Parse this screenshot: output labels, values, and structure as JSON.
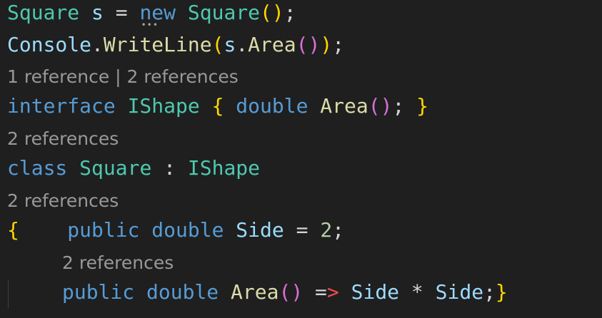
{
  "code": {
    "line1": {
      "type_square": "Square",
      "var_s": " s ",
      "eq": "= ",
      "kw_new": "new",
      "sp": " ",
      "type_square2": "Square",
      "paren_open": "(",
      "paren_close": ")",
      "semi": ";"
    },
    "line2": {
      "console": "Console",
      "dot": ".",
      "writeline": "WriteLine",
      "paren_open": "(",
      "s": "s",
      "dot2": ".",
      "area": "Area",
      "inner_open": "(",
      "inner_close": ")",
      "paren_close": ")",
      "semi": ";"
    },
    "lens1": "1 reference | 2 references",
    "line3": {
      "kw_interface": "interface",
      "type_ishape": " IShape ",
      "brace_open": "{",
      "kw_double": " double ",
      "area": "Area",
      "p_open": "(",
      "p_close": ")",
      "semi": "; ",
      "brace_close": "}"
    },
    "lens2": "2 references",
    "line4": {
      "kw_class": "class",
      "type_square": " Square ",
      "colon": ": ",
      "type_ishape": "IShape"
    },
    "lens3": "2 references",
    "line5": {
      "brace_open": "{",
      "kw_public": "    public",
      "kw_double": " double ",
      "side": "Side",
      "eq": " = ",
      "num": "2",
      "semi": ";"
    },
    "lens4": "2 references",
    "line6": {
      "kw_public": "public",
      "kw_double": " double ",
      "area": "Area",
      "p_open": "(",
      "p_close": ")",
      "arrow_eq": " =",
      "arrow_gt": ">",
      "side1": " Side",
      "star": " * ",
      "side2": "Side",
      "semi": ";",
      "brace_close": "}"
    }
  },
  "colors": {
    "background": "#1f1f1f",
    "type": "#4ec9b0",
    "keyword": "#569cd6",
    "function": "#dcdcaa",
    "identifier": "#9cdcfe",
    "bracket1": "#ffd700",
    "bracket2": "#da70d6",
    "number": "#b5cea8",
    "codelens": "#999999"
  }
}
